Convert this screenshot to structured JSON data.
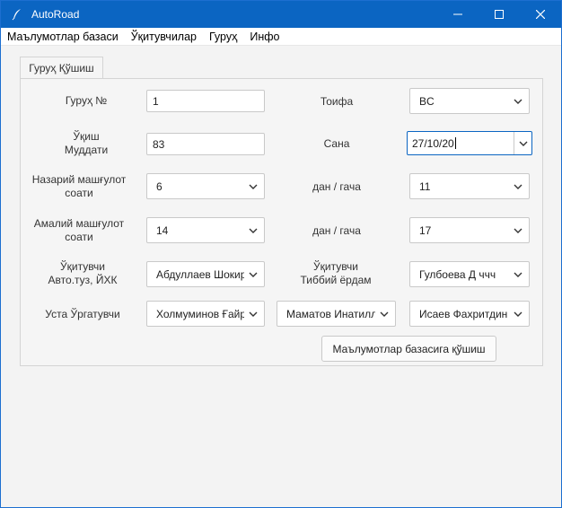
{
  "window": {
    "title": "AutoRoad"
  },
  "menu": [
    "Маълумотлар базаси",
    "Ўқитувчилар",
    "Гуруҳ",
    "Инфо"
  ],
  "tab": {
    "label": "Гуруҳ Қўшиш"
  },
  "form": {
    "group_no": {
      "label": "Гуруҳ №",
      "value": "1"
    },
    "category": {
      "label": "Тоифа",
      "value": "BC"
    },
    "duration": {
      "label_line1": "Ўқиш",
      "label_line2": "Муддати",
      "value": "83"
    },
    "date": {
      "label": "Сана",
      "value": "27/10/20"
    },
    "theory": {
      "label_line1": "Назарий машғулот",
      "label_line2": "соати",
      "value": "6"
    },
    "theory_range": {
      "label": "дан / гача",
      "value": "11"
    },
    "practice": {
      "label_line1": "Амалий машғулот",
      "label_line2": "соати",
      "value": "14"
    },
    "practice_range": {
      "label": "дан / гача",
      "value": "17"
    },
    "teacher_auto": {
      "label_line1": "Ўқитувчи",
      "label_line2": "Авто.туз, ЙХК",
      "value": "Абдуллаев Шокир"
    },
    "teacher_med": {
      "label_line1": "Ўқитувчи",
      "label_line2": "Тиббий ёрдам",
      "value": "Гулбоева Д ччч"
    },
    "master": {
      "label": "Уста Ўргатувчи",
      "values": [
        "Холмуминов Ғайрат",
        "Маматов Инатилло",
        "Исаев Фахритдин"
      ]
    }
  },
  "submit_label": "Маълумотлар базасига қўшиш",
  "colors": {
    "titlebar": "#0b65c2",
    "focus_border": "#0b65c2"
  }
}
